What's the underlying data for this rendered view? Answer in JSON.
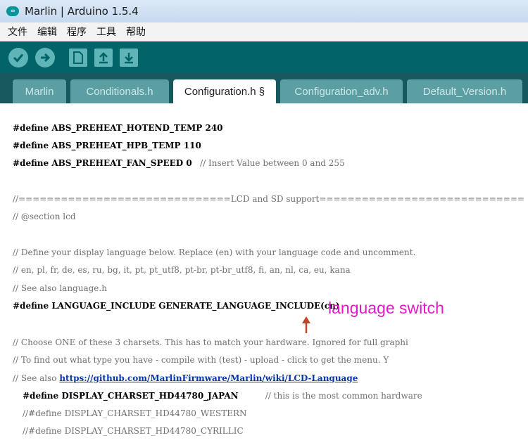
{
  "window": {
    "title": "Marlin | Arduino 1.5.4"
  },
  "menu": [
    "文件",
    "编辑",
    "程序",
    "工具",
    "帮助"
  ],
  "toolbar": {
    "verify_icon": "check-icon",
    "upload_icon": "arrow-right-icon",
    "new_icon": "page-icon",
    "open_icon": "arrow-up-icon",
    "save_icon": "arrow-down-icon"
  },
  "tabs": [
    {
      "label": "Marlin",
      "active": false
    },
    {
      "label": "Conditionals.h",
      "active": false
    },
    {
      "label": "Configuration.h §",
      "active": true
    },
    {
      "label": "Configuration_adv.h",
      "active": false
    },
    {
      "label": "Default_Version.h",
      "active": false
    }
  ],
  "code": {
    "l1": {
      "kw": "#define",
      "text": " ABS_PREHEAT_HOTEND_TEMP 240"
    },
    "l2": {
      "kw": "#define",
      "text": " ABS_PREHEAT_HPB_TEMP 110"
    },
    "l3": {
      "kw": "#define",
      "text": " ABS_PREHEAT_FAN_SPEED 0",
      "comment": "   // Insert Value between 0 and 255"
    },
    "l4": "//==============================LCD and SD support=============================",
    "l5": "// @section lcd",
    "l6": "// Define your display language below. Replace (en) with your language code and uncomment.",
    "l7": "// en, pl, fr, de, es, ru, bg, it, pt, pt_utf8, pt-br, pt-br_utf8, fi, an, nl, ca, eu, kana",
    "l8": "// See also language.h",
    "l9": {
      "kw": "#define",
      "text": " LANGUAGE_INCLUDE GENERATE_LANGUAGE_INCLUDE(cn)"
    },
    "l10": "// Choose ONE of these 3 charsets. This has to match your hardware. Ignored for full graphi",
    "l11": "// To find out what type you have - compile with (test) - upload - click to get the menu. Y",
    "l12": {
      "text": "// See also ",
      "link": "https://github.com/MarlinFirmware/Marlin/wiki/LCD-Language"
    },
    "l13": {
      "kw": "#define",
      "text": " DISPLAY_CHARSET_HD44780_JAPAN",
      "comment": "          // this is the most common hardware"
    },
    "l14": "//#define DISPLAY_CHARSET_HD44780_WESTERN",
    "l15": "//#define DISPLAY_CHARSET_HD44780_CYRILLIC"
  },
  "annotation": {
    "text": "language switch",
    "color": "#e01ac8",
    "arrow_color": "#c0442a"
  },
  "colors": {
    "toolbar": "#006468",
    "tabbar": "#17585c",
    "tab_inactive": "#5b9fa3",
    "button": "#5fb4b8"
  }
}
